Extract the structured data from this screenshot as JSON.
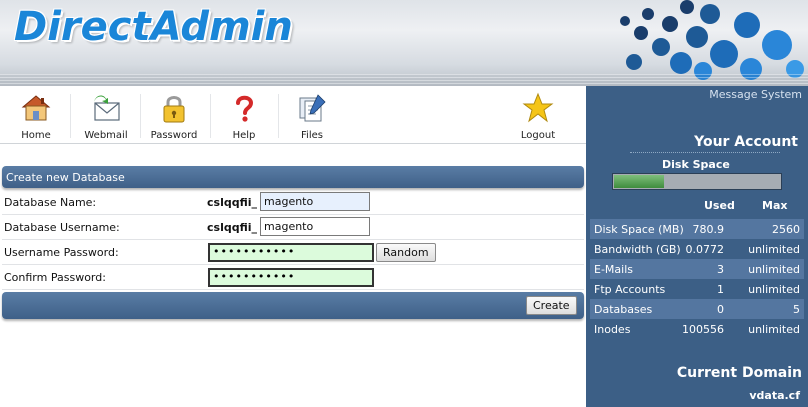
{
  "header": {
    "logo_text": "DirectAdmin"
  },
  "toolbar": {
    "items": [
      {
        "label": "Home",
        "icon": "home-icon"
      },
      {
        "label": "Webmail",
        "icon": "envelope-icon"
      },
      {
        "label": "Password",
        "icon": "lock-icon"
      },
      {
        "label": "Help",
        "icon": "question-icon"
      },
      {
        "label": "Files",
        "icon": "files-icon"
      },
      {
        "label": "Logout",
        "icon": "star-icon"
      }
    ]
  },
  "form": {
    "title": "Create new Database",
    "db_name_label": "Database Name:",
    "db_prefix": "cslqqfii_",
    "db_name_value": "magento",
    "db_user_label": "Database Username:",
    "db_user_value": "magento",
    "password_label": "Username Password:",
    "password_value": "•••••••••••",
    "random_label": "Random",
    "confirm_label": "Confirm Password:",
    "confirm_value": "•••••••••••",
    "create_label": "Create"
  },
  "sidebar": {
    "message_system": "Message System",
    "your_account": "Your Account",
    "disk_space_label": "Disk Space",
    "disk_usage_fraction": 0.3,
    "col_used": "Used",
    "col_max": "Max",
    "stats": [
      {
        "name": "Disk Space (MB)",
        "used": "780.9",
        "max": "2560"
      },
      {
        "name": "Bandwidth (GB)",
        "used": "0.0772",
        "max": "unlimited"
      },
      {
        "name": "E-Mails",
        "used": "3",
        "max": "unlimited"
      },
      {
        "name": "Ftp Accounts",
        "used": "1",
        "max": "unlimited"
      },
      {
        "name": "Databases",
        "used": "0",
        "max": "5"
      },
      {
        "name": "Inodes",
        "used": "100556",
        "max": "unlimited"
      }
    ],
    "current_domain_label": "Current Domain",
    "current_domain": "vdata.cf"
  },
  "colors": {
    "accent_blue": "#1a86d8",
    "sidebar_bg": "#3c5f86",
    "panel_bar": "#4a6c94",
    "disk_fill": "#4f9a4c"
  }
}
